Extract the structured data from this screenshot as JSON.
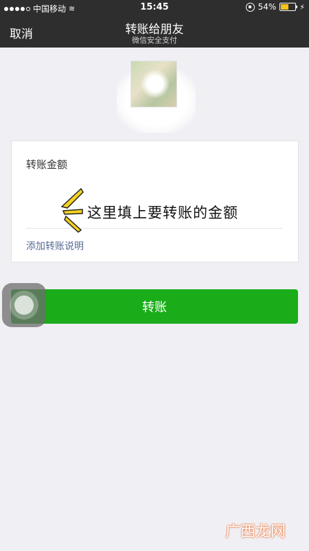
{
  "status_bar": {
    "carrier": "中国移动",
    "time": "15:45",
    "battery_percent": "54%",
    "battery_level": 0.54,
    "battery_color": "#f7c21c"
  },
  "nav": {
    "cancel_label": "取消",
    "title": "转账给朋友",
    "subtitle": "微信安全支付"
  },
  "form": {
    "amount_label": "转账金额",
    "amount_value": "",
    "add_note_label": "添加转账说明"
  },
  "annotation": {
    "text": "这里填上要转账的金额"
  },
  "actions": {
    "transfer_label": "转账"
  },
  "watermark": {
    "text": "广西龙网"
  },
  "colors": {
    "nav_bg": "#2e2e2e",
    "primary_green": "#1aad19",
    "link_blue": "#576b95",
    "page_bg": "#efeff4"
  }
}
